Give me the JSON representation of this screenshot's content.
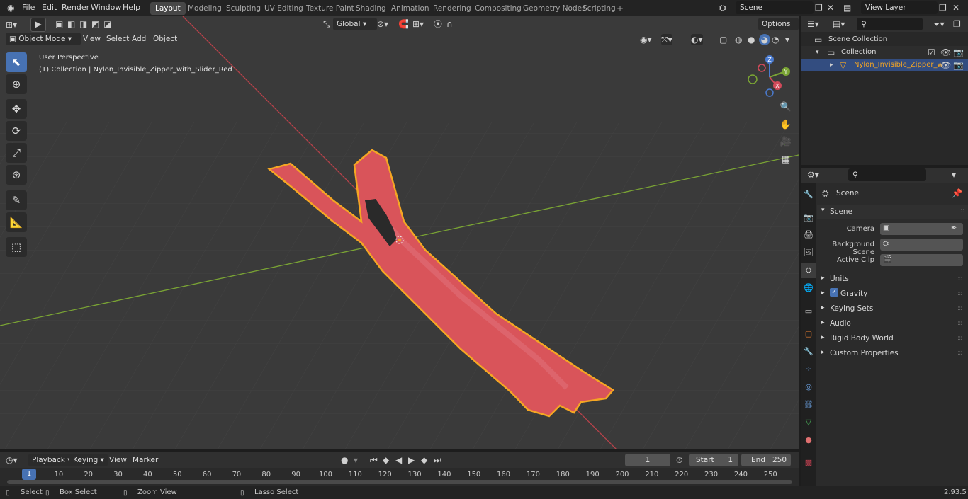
{
  "menu": [
    "File",
    "Edit",
    "Render",
    "Window",
    "Help"
  ],
  "workspaces": [
    "Layout",
    "Modeling",
    "Sculpting",
    "UV Editing",
    "Texture Paint",
    "Shading",
    "Animation",
    "Rendering",
    "Compositing",
    "Geometry Nodes",
    "Scripting"
  ],
  "workspace_active": "Layout",
  "scene_name": "Scene",
  "view_layer": "View Layer",
  "viewport": {
    "mode": "Object Mode",
    "menus": [
      "View",
      "Select",
      "Add",
      "Object"
    ],
    "transform_orientation": "Global",
    "options": "Options",
    "overlay_title": "User Perspective",
    "overlay_object": "(1) Collection | Nylon_Invisible_Zipper_with_Slider_Red",
    "gizmo_axes": {
      "x": "X",
      "y": "Y",
      "z": "Z"
    }
  },
  "outliner": {
    "scene_collection": "Scene Collection",
    "collection": "Collection",
    "object": "Nylon_Invisible_Zipper_w"
  },
  "properties": {
    "context": "Scene",
    "panel": "Scene",
    "camera_label": "Camera",
    "background_scene_label": "Background Scene",
    "active_clip_label": "Active Clip",
    "subpanels": [
      "Units",
      "Gravity",
      "Keying Sets",
      "Audio",
      "Rigid Body World",
      "Custom Properties"
    ],
    "gravity_enabled": true
  },
  "timeline": {
    "menus": [
      "Playback",
      "Keying",
      "View",
      "Marker"
    ],
    "current_frame": "1",
    "start_label": "Start",
    "start_value": "1",
    "end_label": "End",
    "end_value": "250",
    "frame_ticks": [
      "10",
      "20",
      "30",
      "40",
      "50",
      "60",
      "70",
      "80",
      "90",
      "100",
      "110",
      "120",
      "130",
      "140",
      "150",
      "160",
      "170",
      "180",
      "190",
      "200",
      "210",
      "220",
      "230",
      "240",
      "250"
    ],
    "playhead": "1"
  },
  "statusbar": {
    "select": "Select",
    "box_select": "Box Select",
    "zoom_view": "Zoom View",
    "lasso_select": "Lasso Select",
    "version": "2.93.5"
  },
  "colors": {
    "accent": "#4772b3",
    "selected_outline": "#f5a623",
    "zipper": "#d9545a",
    "x_axis": "#b7424a",
    "y_axis": "#7aa434"
  }
}
